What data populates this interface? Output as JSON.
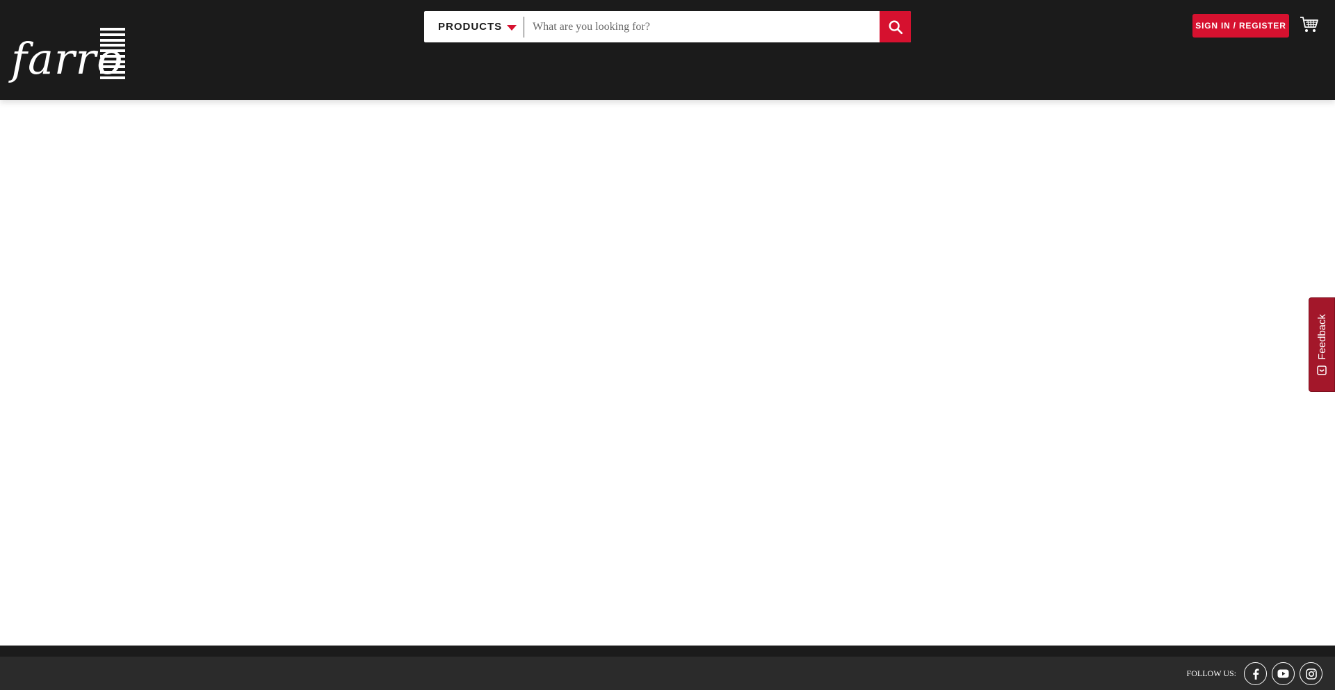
{
  "brand": {
    "logo_text": "farro",
    "accent_color": "#d6112f",
    "header_color": "#1b1b1b"
  },
  "search": {
    "category_label": "PRODUCTS",
    "placeholder": "What are you looking for?",
    "button_icon": "search-icon"
  },
  "account": {
    "signin_label": "SIGN IN / REGISTER",
    "cart_icon": "cart-icon"
  },
  "feedback": {
    "label": "Feedback",
    "icon": "feedback-icon"
  },
  "footer": {
    "follow_label": "FOLLOW US:",
    "social": [
      "facebook-icon",
      "youtube-icon",
      "instagram-icon"
    ]
  }
}
